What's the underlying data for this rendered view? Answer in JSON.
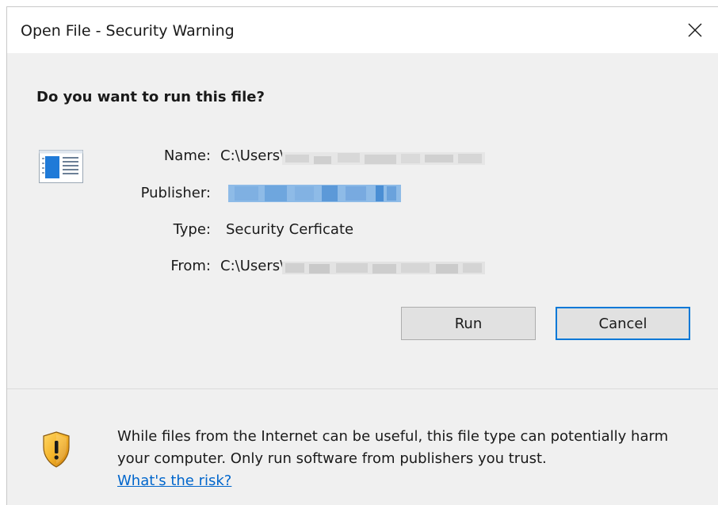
{
  "window": {
    "title": "Open File - Security Warning",
    "close_icon": "close-icon"
  },
  "prompt": {
    "question": "Do you want to run this file?"
  },
  "details": {
    "name_label": "Name:",
    "name_value": "C:\\Users\\",
    "publisher_label": "Publisher:",
    "type_label": "Type:",
    "type_value": "Security Cerficate",
    "from_label": "From:",
    "from_value": "C:\\Users\\"
  },
  "buttons": {
    "run_label": "Run",
    "cancel_label": "Cancel"
  },
  "footer": {
    "warning_text": "While files from the Internet can be useful, this file type can potentially harm your computer. Only run software from publishers you trust.",
    "risk_link": "What's the risk?"
  },
  "colors": {
    "accent": "#0078d7",
    "link": "#0066cc",
    "background": "#f0f0f0",
    "titlebar": "#ffffff"
  },
  "icons": [
    "close-icon",
    "file-icon",
    "shield-warning-icon"
  ]
}
